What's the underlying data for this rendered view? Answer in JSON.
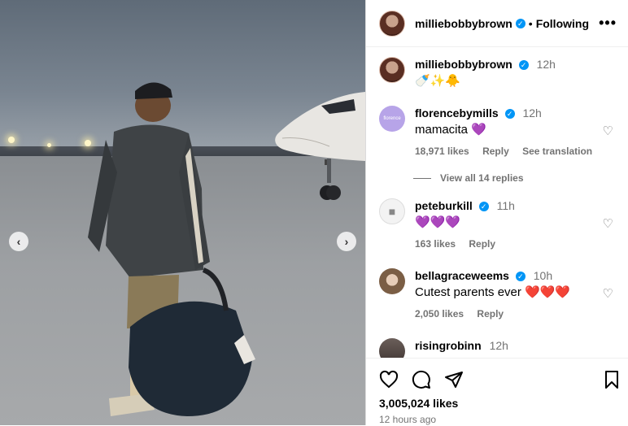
{
  "post": {
    "author": "milliebobbybrown",
    "follow_state": "Following",
    "caption_time": "12h",
    "caption_text": "🍼✨🐥",
    "likes": "3,005,024 likes",
    "posted_ago": "12 hours ago"
  },
  "icons": {
    "prev": "chevron-left-icon",
    "next": "chevron-right-icon",
    "more": "more-options-icon",
    "like": "heart-icon",
    "comment": "comment-icon",
    "share": "share-icon",
    "save": "bookmark-icon"
  },
  "comments": [
    {
      "user": "florencebymills",
      "time": "12h",
      "text": "mamacita 💜",
      "likes": "18,971 likes",
      "reply": "Reply",
      "translate": "See translation",
      "view_replies": "View all 14 replies",
      "verified": true
    },
    {
      "user": "peteburkill",
      "time": "11h",
      "text": "💜💜💜",
      "likes": "163 likes",
      "reply": "Reply",
      "verified": true
    },
    {
      "user": "bellagraceweems",
      "time": "10h",
      "text": "Cutest parents ever ❤️❤️❤️",
      "likes": "2,050 likes",
      "reply": "Reply",
      "verified": true
    },
    {
      "user": "risingrobinn",
      "time": "12h",
      "verified": false
    }
  ],
  "colors": {
    "verified": "#0095f6",
    "muted_text": "#737373",
    "divider": "#efefef"
  }
}
